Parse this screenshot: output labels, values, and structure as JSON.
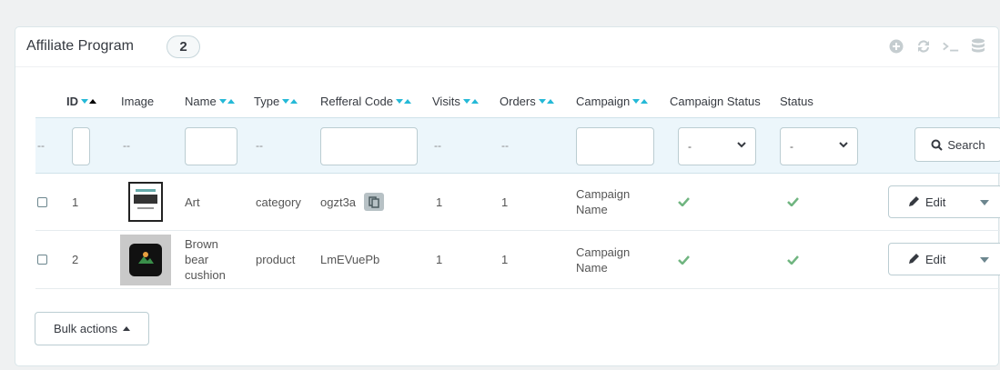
{
  "panel": {
    "title": "Affiliate Program",
    "count": "2",
    "toolbar_icons": [
      "add-icon",
      "refresh-icon",
      "terminal-icon",
      "database-icon"
    ]
  },
  "columns": {
    "id": "ID",
    "image": "Image",
    "name": "Name",
    "type": "Type",
    "refferal_code": "Refferal Code",
    "visits": "Visits",
    "orders": "Orders",
    "campaign": "Campaign",
    "campaign_status": "Campaign Status",
    "status": "Status"
  },
  "filters": {
    "placeholder_dash": "--",
    "campaign_status_value": "-",
    "status_value": "-",
    "search_label": "Search"
  },
  "rows": [
    {
      "id": "1",
      "image_icon": "poster-thumbnail",
      "name": "Art",
      "type": "category",
      "code": "ogzt3a",
      "visits": "1",
      "orders": "1",
      "campaign": "Campaign Name",
      "campaign_status": "active",
      "status": "active",
      "edit_label": "Edit"
    },
    {
      "id": "2",
      "image_icon": "cushion-thumbnail",
      "name": "Brown bear cushion",
      "type": "product",
      "code": "LmEVuePb",
      "visits": "1",
      "orders": "1",
      "campaign": "Campaign Name",
      "campaign_status": "active",
      "status": "active",
      "edit_label": "Edit"
    }
  ],
  "footer": {
    "bulk_actions_label": "Bulk actions"
  },
  "colors": {
    "accent": "#25b9d7",
    "success": "#70b580",
    "filter_bg": "#ecf6fb"
  }
}
